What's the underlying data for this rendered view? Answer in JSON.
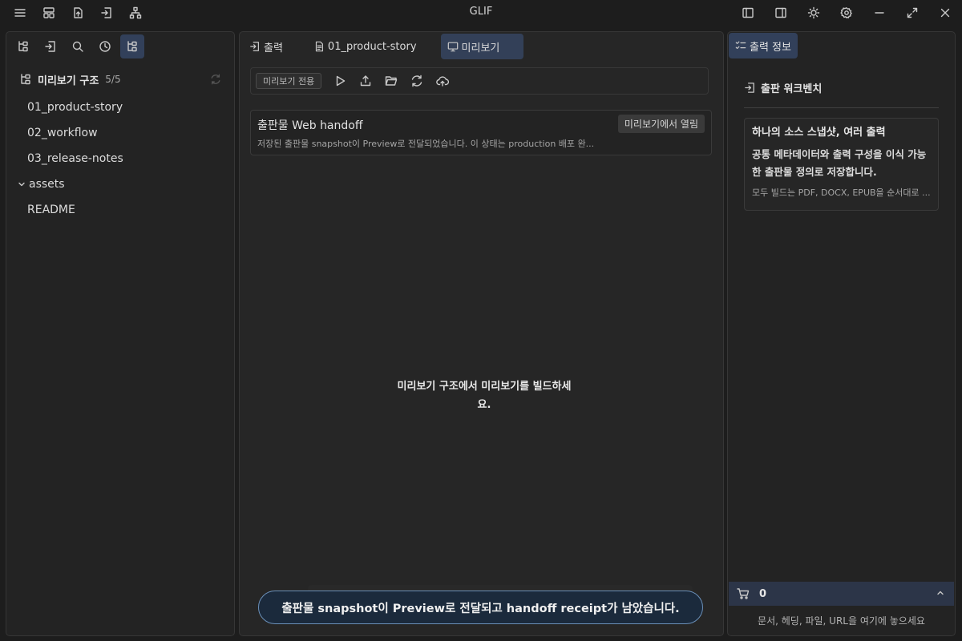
{
  "app": {
    "title": "GLIF"
  },
  "titlebar": {
    "left_icons": [
      "menu-icon",
      "layout-icon",
      "export-file-icon",
      "import-icon",
      "sitemap-icon"
    ],
    "right_icons": [
      "left-sidebar-icon",
      "right-sidebar-icon",
      "theme-sun-icon",
      "settings-icon",
      "minimize-icon",
      "maximize-icon",
      "close-icon"
    ]
  },
  "left_panel": {
    "nav_icons": [
      "tree-icon",
      "import-icon",
      "search-icon",
      "history-icon",
      "tree-icon"
    ],
    "tree_title": "미리보기 구조",
    "tree_count": "5/5",
    "items": [
      {
        "label": "01_product-story"
      },
      {
        "label": "02_workflow"
      },
      {
        "label": "03_release-notes"
      },
      {
        "label": "assets",
        "folder": true
      },
      {
        "label": "README"
      }
    ]
  },
  "center": {
    "tabs": [
      {
        "label": "출력",
        "icon": "output-icon"
      },
      {
        "label": "01_product-story",
        "icon": "document-icon"
      },
      {
        "label": "미리보기",
        "icon": "monitor-icon",
        "active": true
      }
    ],
    "toolbar": {
      "mode_pill": "미리보기 전용"
    },
    "card": {
      "title": "출판물 Web handoff",
      "badge": "미리보기에서 열림",
      "desc": "저장된 출판물 snapshot이 Preview로 전달되었습니다. 이 상태는 production 배포 완..."
    },
    "empty_message_line1": "미리보기 구조에서 미리보기를 빌드하세",
    "empty_message_line2": "요."
  },
  "right_panel": {
    "tab_label": "출력 정보",
    "section_title": "출판 워크벤치",
    "card_title": "하나의 소스 스냅샷, 여러 출력",
    "card_text_line1": "공통 메타데이터와 출력 구성을 이식 가능",
    "card_text_line2": "한 출판물 정의로 저장합니다.",
    "card_sub": "모두 빌드는 PDF, DOCX, EPUB을 순서대로 ...",
    "cart_count": "0",
    "drop_hint": "문서, 헤딩, 파일, URL을 여기에 놓으세요"
  },
  "toast": {
    "message": "출판물 snapshot이 Preview로 전달되고 handoff receipt가 남았습니다."
  },
  "colors": {
    "accent": "#32405a",
    "toast_border": "#6a8fb8",
    "background": "#1d1d1d"
  }
}
